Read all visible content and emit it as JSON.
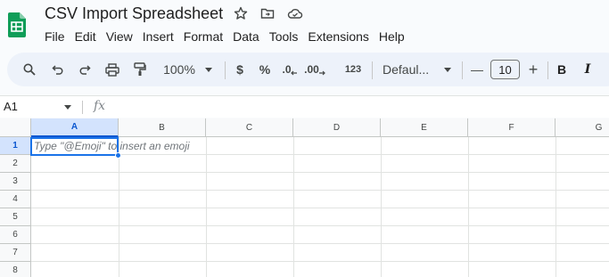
{
  "doc": {
    "title": "CSV Import Spreadsheet"
  },
  "menu": [
    "File",
    "Edit",
    "View",
    "Insert",
    "Format",
    "Data",
    "Tools",
    "Extensions",
    "Help"
  ],
  "toolbar": {
    "zoom": "100%",
    "currency": "$",
    "percent": "%",
    "dec_decrease": ".0",
    "dec_increase": ".00",
    "number_format": "123",
    "font": "Defaul...",
    "font_size": "10",
    "minus": "—",
    "plus": "+",
    "bold": "B",
    "italic": "I"
  },
  "formula_bar": {
    "name_box": "A1",
    "fx": "fx"
  },
  "grid": {
    "columns": [
      "A",
      "B",
      "C",
      "D",
      "E",
      "F",
      "G"
    ],
    "rows": [
      "1",
      "2",
      "3",
      "4",
      "5",
      "6",
      "7",
      "8"
    ],
    "cell_hint": "Type \"@Emoji\" to insert an emoji"
  },
  "colors": {
    "accent": "#0b57d0",
    "selection": "#d3e3fd",
    "sheets_green": "#0f9d58"
  }
}
